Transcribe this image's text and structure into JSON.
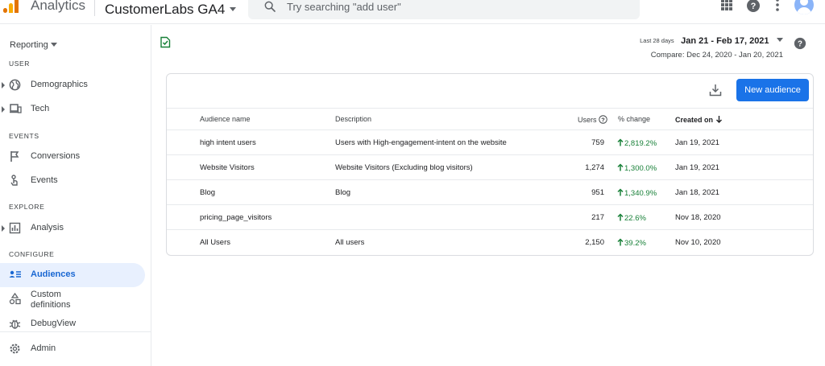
{
  "topbar": {
    "app_title": "Analytics",
    "property_name": "CustomerLabs GA4",
    "search_placeholder": "Try searching \"add user\""
  },
  "sidebar": {
    "reporting_label": "Reporting",
    "sections": {
      "user": "USER",
      "events": "EVENTS",
      "explore": "EXPLORE",
      "configure": "CONFIGURE"
    },
    "items": {
      "demographics": "Demographics",
      "tech": "Tech",
      "conversions": "Conversions",
      "events": "Events",
      "analysis": "Analysis",
      "audiences": "Audiences",
      "custom_definitions": "Custom definitions",
      "debugview": "DebugView",
      "admin": "Admin"
    },
    "active_item": "audiences"
  },
  "date_range": {
    "last_label": "Last 28 days",
    "range": "Jan 21 - Feb 17, 2021",
    "compare": "Compare: Dec 24, 2020 - Jan 20, 2021"
  },
  "audiences_table": {
    "new_audience_label": "New audience",
    "columns": {
      "name": "Audience name",
      "description": "Description",
      "users": "Users",
      "change": "% change",
      "created": "Created on"
    },
    "rows": [
      {
        "name": "high intent users",
        "description": "Users with High-engagement-intent on the website",
        "users": "759",
        "change": "2,819.2%",
        "created": "Jan 19, 2021"
      },
      {
        "name": "Website Visitors",
        "description": "Website Visitors (Excluding blog visitors)",
        "users": "1,274",
        "change": "1,300.0%",
        "created": "Jan 19, 2021"
      },
      {
        "name": "Blog",
        "description": "Blog",
        "users": "951",
        "change": "1,340.9%",
        "created": "Jan 18, 2021"
      },
      {
        "name": "pricing_page_visitors",
        "description": "",
        "users": "217",
        "change": "22.6%",
        "created": "Nov 18, 2020"
      },
      {
        "name": "All Users",
        "description": "All users",
        "users": "2,150",
        "change": "39.2%",
        "created": "Nov 10, 2020"
      }
    ]
  },
  "colors": {
    "accent": "#1a73e8",
    "positive": "#188038",
    "active_bg": "#e8f0fe",
    "analytics_orange": "#e37400",
    "analytics_yellow": "#f9ab00"
  },
  "icons": {
    "logo": "analytics-logo-icon",
    "search": "search-icon",
    "apps": "apps-grid-icon",
    "help": "help-icon",
    "more": "more-vert-icon",
    "account": "account-avatar-icon",
    "demographics": "globe-icon",
    "tech": "devices-icon",
    "conversions": "flag-icon",
    "events": "touch-icon",
    "analysis": "analysis-icon",
    "audiences": "audience-icon",
    "custom_definitions": "shapes-icon",
    "debugview": "bug-icon",
    "admin": "gear-icon",
    "data_quality": "check-icon",
    "download": "download-icon",
    "users_help": "help-outline-icon",
    "sort": "arrow-down-icon",
    "change_up": "arrow-up-icon"
  }
}
